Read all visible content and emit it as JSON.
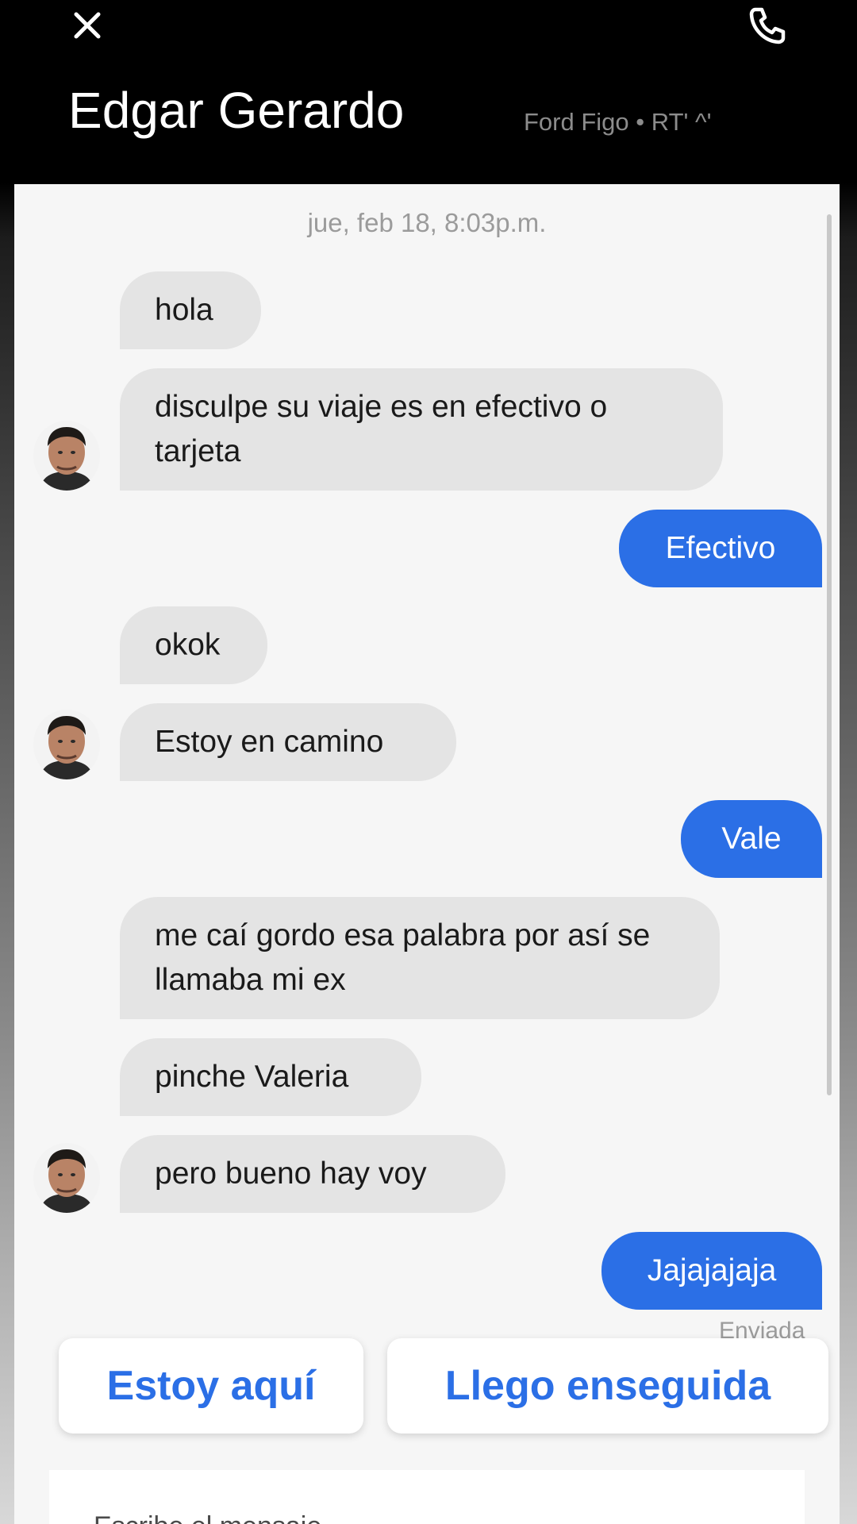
{
  "header": {
    "driver_name": "Edgar Gerardo",
    "vehicle": "Ford Figo • RT' ^'",
    "close_icon": "close-icon",
    "call_icon": "phone-icon"
  },
  "chat": {
    "timestamp": "jue, feb 18, 8:03p.m.",
    "messages": [
      {
        "from": "driver",
        "text": "hola"
      },
      {
        "from": "driver",
        "text": "disculpe su viaje es en efectivo o tarjeta"
      },
      {
        "from": "me",
        "text": "Efectivo"
      },
      {
        "from": "driver",
        "text": "okok"
      },
      {
        "from": "driver",
        "text": "Estoy en camino"
      },
      {
        "from": "me",
        "text": "Vale"
      },
      {
        "from": "driver",
        "text": "me caí gordo esa palabra por así se llamaba mi ex"
      },
      {
        "from": "driver",
        "text": "pinche Valeria"
      },
      {
        "from": "driver",
        "text": "pero bueno hay voy"
      },
      {
        "from": "me",
        "text": "Jajajajaja"
      }
    ],
    "status": "Enviada"
  },
  "quick_replies": [
    "Estoy aquí",
    "Llego enseguida"
  ],
  "composer": {
    "placeholder": "Escribe el mensaje"
  },
  "colors": {
    "accent": "#2b6fe6",
    "received_bubble": "#e4e4e4",
    "header": "#000000"
  }
}
